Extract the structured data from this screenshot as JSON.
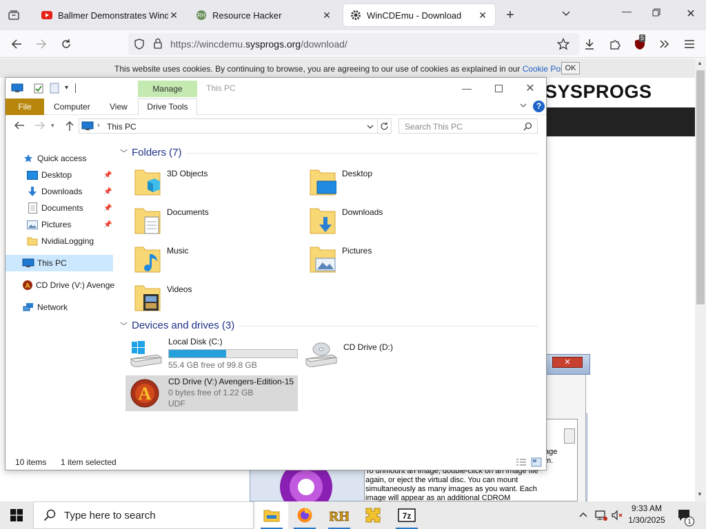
{
  "browser": {
    "tabs": [
      {
        "title": "Ballmer Demonstrates Windows",
        "icon": "youtube-icon"
      },
      {
        "title": "Resource Hacker",
        "icon": "resource-hacker-icon"
      },
      {
        "title": "WinCDEmu - Download",
        "icon": "gear-icon"
      }
    ],
    "active_tab": 2,
    "url_prefix": "https://wincdemu.",
    "url_domain": "sysprogs.org",
    "url_path": "/download/",
    "extension_badge": "5"
  },
  "page": {
    "cookie_text": "This website uses cookies. By continuing to browse, you are agreeing to our use of cookies as explained in our",
    "cookie_link": "Cookie Policy",
    "cookie_period": ".",
    "cookie_ok": "OK",
    "logo_text": "SYSPROGS",
    "bg_text": "To unmount an image, double-click on an image file again, or eject the virtual disc. You can mount simultaneously as many images as you want. Each image will appear as an additional CDROM",
    "bg_text_top": "age",
    "bg_text_top2": "m."
  },
  "explorer": {
    "title": "This PC",
    "manage_label": "Manage",
    "ribbon_tabs": {
      "file": "File",
      "computer": "Computer",
      "view": "View",
      "drive_tools": "Drive Tools"
    },
    "address": "This PC",
    "search_placeholder": "Search This PC",
    "nav": {
      "quick_access": "Quick access",
      "desktop": "Desktop",
      "downloads": "Downloads",
      "documents": "Documents",
      "pictures": "Pictures",
      "nvidia": "NvidiaLogging",
      "this_pc": "This PC",
      "cd_drive": "CD Drive (V:) Avengers-Edition-15",
      "network": "Network"
    },
    "folders_header": "Folders (7)",
    "folders": {
      "objects3d": "3D Objects",
      "desktop": "Desktop",
      "documents": "Documents",
      "downloads": "Downloads",
      "music": "Music",
      "pictures": "Pictures",
      "videos": "Videos"
    },
    "devices_header": "Devices and drives (3)",
    "drives": {
      "c_name": "Local Disk (C:)",
      "c_free": "55.4 GB free of 99.8 GB",
      "c_used_fraction": 0.445,
      "d_name": "CD Drive (D:)",
      "v_name": "CD Drive (V:) Avengers-Edition-15",
      "v_free": "0 bytes free of 1.22 GB",
      "v_fs": "UDF"
    },
    "status_items": "10 items",
    "status_selected": "1 item selected"
  },
  "taskbar": {
    "search_placeholder": "Type here to search",
    "time": "9:33 AM",
    "date": "1/30/2025",
    "notification_count": "1",
    "apps": [
      "file-explorer-icon",
      "firefox-icon",
      "resource-hacker-icon",
      "puzzle-app-icon",
      "7zip-icon"
    ]
  },
  "colors": {
    "accent": "#26a0da",
    "file_tab": "#b8860b",
    "manage_tab": "#c5eab1",
    "folder_header": "#1e3287",
    "selection": "#cce8ff"
  }
}
